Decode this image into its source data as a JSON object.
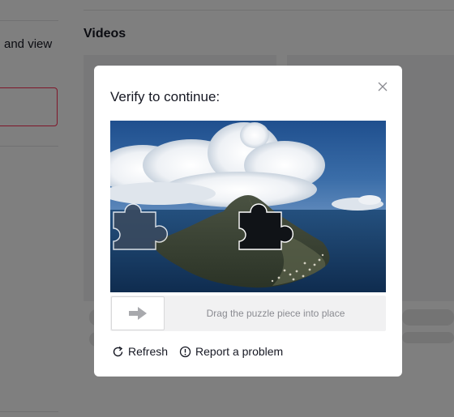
{
  "background": {
    "left_text": "and view",
    "section_heading": "Videos"
  },
  "captcha": {
    "title": "Verify to continue:",
    "slider_hint": "Drag the puzzle piece into place",
    "refresh_label": "Refresh",
    "report_label": "Report a problem",
    "colors": {
      "accent": "#fe2c55",
      "text": "#161823",
      "muted": "#8a8b91",
      "track": "#f1f1f2"
    }
  }
}
